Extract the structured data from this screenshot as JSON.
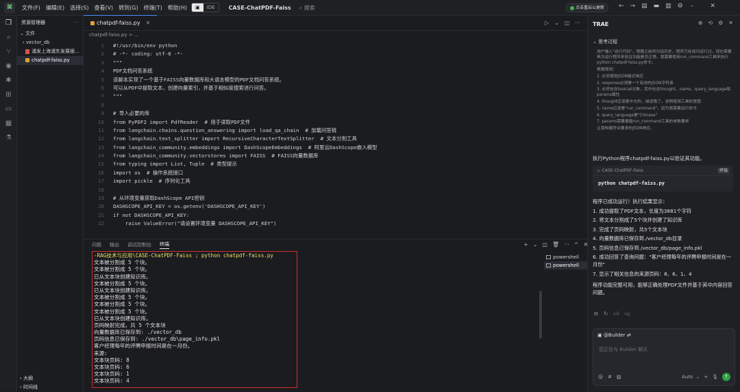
{
  "titlebar": {
    "menus": [
      "文件(F)",
      "编辑(E)",
      "选择(S)",
      "查看(V)",
      "转到(G)",
      "终端(T)",
      "帮助(H)"
    ],
    "ide_label": "IDE",
    "project": "CASE-ChatPDF-Faiss",
    "search": "搜索",
    "update_badge": "点击重启以更新"
  },
  "explorer": {
    "header": "资源管理器",
    "section": "文件",
    "items": [
      "vector_db",
      "浦发上海浦东发展银...",
      "chatpdf-faiss.py"
    ],
    "outline": "大纲",
    "timeline": "时间线"
  },
  "editor": {
    "tab": "chatpdf-faiss.py",
    "breadcrumb": "chatpdf-faiss.py > ...",
    "lines": [
      "#!/usr/bin/env python",
      "# -*- coding: utf-8 -*-",
      "\"\"\"",
      "PDF文档问答系统",
      "该脚本实现了一个基于FAISS向量数据库和大语言模型的PDF文档问答系统。",
      "可以从PDF中提取文本，创建向量索引，并基于相似度搜索进行问答。",
      "\"\"\"",
      "",
      "# 导入必要的库",
      "from PyPDF2 import PdfReader  # 用于读取PDF文件",
      "from langchain.chains.question_answering import load_qa_chain  # 加载问答链",
      "from langchain.text_splitter import RecursiveCharacterTextSplitter  # 文本分割工具",
      "from langchain_community.embeddings import DashScopeEmbeddings  # 阿里云DashScope嵌入模型",
      "from langchain_community.vectorstores import FAISS  # FAISS向量数据库",
      "from typing import List, Tuple  # 类型提示",
      "import os  # 操作系统接口",
      "import pickle  # 序列化工具",
      "",
      "# 从环境变量获取DashScope API密钥",
      "DASHSCOPE_API_KEY = os.getenv('DASHSCOPE_API_KEY')",
      "if not DASHSCOPE_API_KEY:",
      "    raise ValueError(\"请设置环境变量 DASHSCOPE_API_KEY\")"
    ]
  },
  "panel": {
    "tabs": [
      "问题",
      "输出",
      "调试控制台",
      "终端"
    ],
    "terminal": [
      "-RAG技术与应用\\CASE-ChatPDF-Faiss ; python chatpdf-faiss.py",
      "文本被分割成 5 个块。",
      "文本被分割成 5 个块。",
      "已从文本块创建知识库。",
      "文本被分割成 5 个块。",
      "已从文本块创建知识库。",
      "文本被分割成 5 个块。",
      "文本被分割成 5 个块。",
      "文本被分割成 5 个块。",
      "已从文本块创建知识库。",
      "页码映射完成，共 5 个文本块",
      "向量数据库已保存到: ./vector_db",
      "页码信息已保存到: ./vector_db\\page_info.pkl",
      "客户经理每年的评聘申报时间是在一月份。",
      "来源:",
      "文本块页码: 8",
      "文本块页码: 6",
      "文本块页码: 1",
      "文本块页码: 4"
    ],
    "shells": [
      "powershell",
      "powershell"
    ]
  },
  "ai": {
    "title": "TRAE",
    "thinking_header": "思考过程",
    "thinking": [
      "用户输入\"运行代码\"，根据之前的对话历史，程序已经成功运行过，现在需要再次运行程序来验证功能是否正常。我需要使用run_command工具来执行python chatpdf-faiss.py命令。",
      "根据规则：",
      "1. 必须使用JSON格式响应",
      "2. response必须是一个有效的JSON字符串",
      "3. 必须包含toolcall对象，其中包含thought、name、query_language和params属性",
      "4. thought应该是中文的，描述我了，说明使用工具的意图",
      "5. name应该是\"run_command\"，因为我需要运行命令",
      "6. query_language是\"Chinese\"",
      "7. params需要遵循run_command工具的参数要求",
      "让我构建符合要求的JSON响应。"
    ],
    "intro": "执行Python程序chatpdf-faiss.py以验证其功能。",
    "cmd_project": "CASE-ChatPDF-Faiss",
    "cmd_run": "终端",
    "cmd": "python chatpdf-faiss.py",
    "result_head": "程序已成功运行！执行结果显示：",
    "results": [
      "1. 成功提取了PDF文本，长度为3881个字符",
      "2. 将文本分割成了5个块并创建了知识库",
      "3. 完成了页码映射，共5个文本块",
      "4. 向量数据库已保存到./vector_db目录",
      "5. 页码信息已保存到./vector_db/page_info.pkl",
      "6. 成功回答了查询问题：\"客户经理每年的评聘申报时间是在一月份\"",
      "7. 显示了相关信息的来源页码：8、6、1、4"
    ],
    "conclusion": "程序功能完整可用，能够正确处理PDF文件并基于其中内容回答问题。",
    "builder": "@Builder",
    "placeholder": "您正在与 Builder 聊天",
    "auto": "Auto"
  }
}
